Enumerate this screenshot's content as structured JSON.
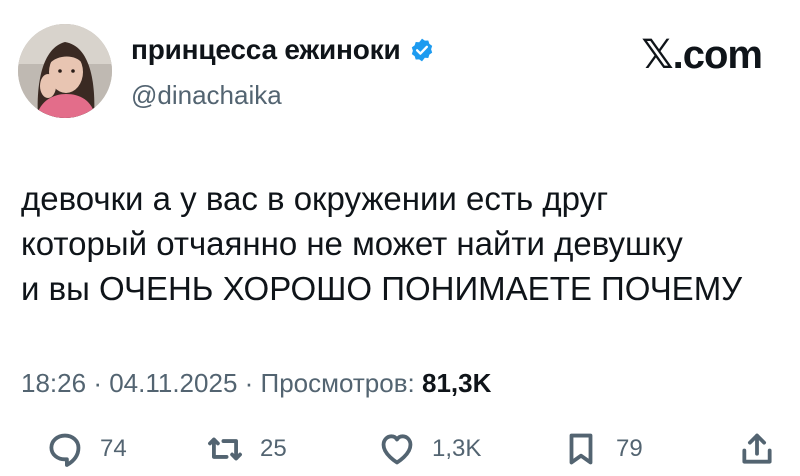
{
  "author": {
    "display_name": "принцесса ежиноки",
    "handle": "@dinachaika",
    "verified": true,
    "verified_color": "#1d9bf0"
  },
  "brand": "𝕏.com",
  "tweet": {
    "lines": [
      "девочки а у вас в окружении есть друг",
      "который отчаянно не может найти девушку",
      "и вы ОЧЕНЬ ХОРОШО ПОНИМАЕТЕ ПОЧЕМУ"
    ]
  },
  "meta": {
    "time": "18:26",
    "date": "04.11.2025",
    "views_label": "Просмотров:",
    "views_count": "81,3K"
  },
  "actions": {
    "replies": "74",
    "retweets": "25",
    "likes": "1,3K",
    "bookmarks": "79",
    "icons": [
      "reply-icon",
      "retweet-icon",
      "like-icon",
      "bookmark-icon",
      "share-icon"
    ]
  }
}
